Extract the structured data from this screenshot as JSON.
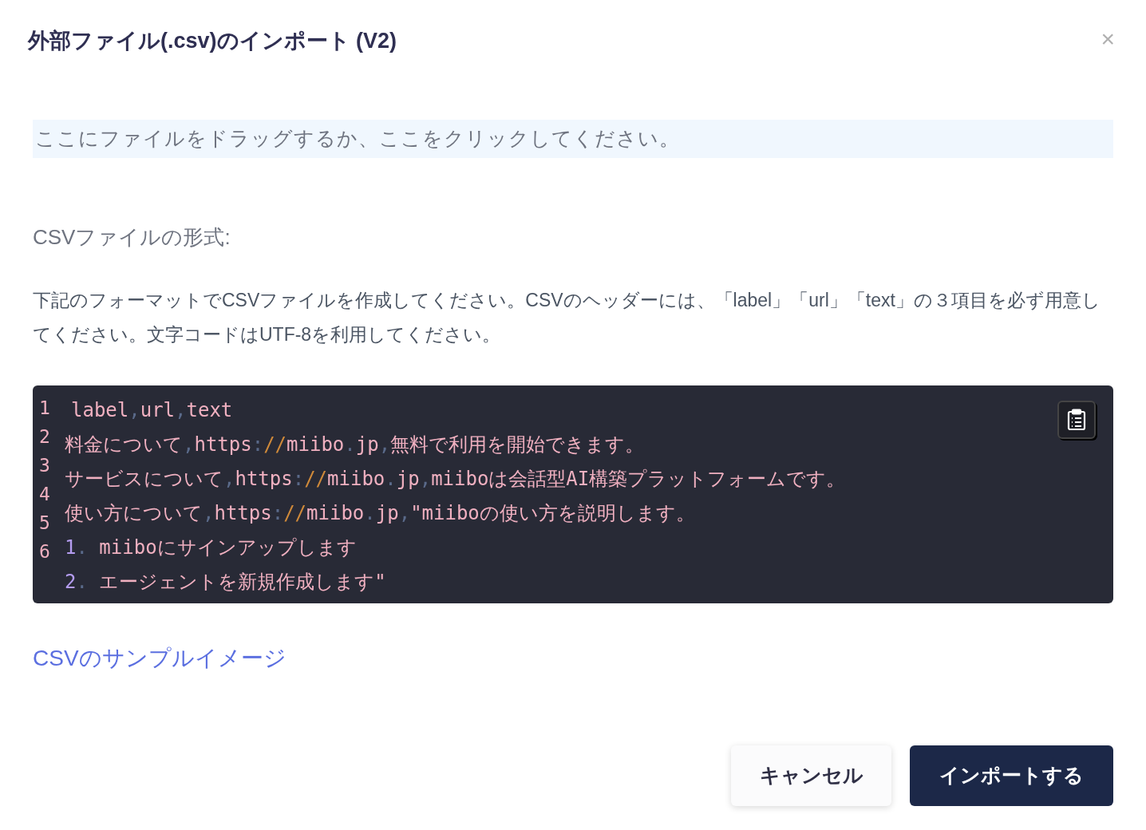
{
  "dialog": {
    "title": "外部ファイル(.csv)のインポート (V2)",
    "close": "×"
  },
  "dropzone": {
    "text": "ここにファイルをドラッグするか、ここをクリックしてください。"
  },
  "format_heading": "CSVファイルの形式:",
  "description": "下記のフォーマットでCSVファイルを作成してください。CSVのヘッダーには、「label」「url」「text」の３項目を必ず用意してください。文字コードはUTF-8を利用してください。",
  "code": {
    "line_numbers": [
      "1",
      "2",
      "3",
      "4",
      "5",
      "6"
    ],
    "lines": [
      [
        {
          "kind": "text",
          "text": "label"
        },
        {
          "kind": "punct",
          "text": ","
        },
        {
          "kind": "text",
          "text": "url"
        },
        {
          "kind": "punct",
          "text": ","
        },
        {
          "kind": "text",
          "text": "text"
        }
      ],
      [
        {
          "kind": "text",
          "text": "料金について"
        },
        {
          "kind": "punct",
          "text": ","
        },
        {
          "kind": "text",
          "text": "https"
        },
        {
          "kind": "punct",
          "text": ":"
        },
        {
          "kind": "slash",
          "text": "//"
        },
        {
          "kind": "text",
          "text": "miibo"
        },
        {
          "kind": "punct",
          "text": "."
        },
        {
          "kind": "text",
          "text": "jp"
        },
        {
          "kind": "punct",
          "text": ","
        },
        {
          "kind": "text",
          "text": "無料で利用を開始できます。"
        }
      ],
      [
        {
          "kind": "text",
          "text": "サービスについて"
        },
        {
          "kind": "punct",
          "text": ","
        },
        {
          "kind": "text",
          "text": "https"
        },
        {
          "kind": "punct",
          "text": ":"
        },
        {
          "kind": "slash",
          "text": "//"
        },
        {
          "kind": "text",
          "text": "miibo"
        },
        {
          "kind": "punct",
          "text": "."
        },
        {
          "kind": "text",
          "text": "jp"
        },
        {
          "kind": "punct",
          "text": ","
        },
        {
          "kind": "text",
          "text": "miiboは会話型AI構築プラットフォームです。"
        }
      ],
      [
        {
          "kind": "text",
          "text": "使い方について"
        },
        {
          "kind": "punct",
          "text": ","
        },
        {
          "kind": "text",
          "text": "https"
        },
        {
          "kind": "punct",
          "text": ":"
        },
        {
          "kind": "slash",
          "text": "//"
        },
        {
          "kind": "text",
          "text": "miibo"
        },
        {
          "kind": "punct",
          "text": "."
        },
        {
          "kind": "text",
          "text": "jp"
        },
        {
          "kind": "punct",
          "text": ","
        },
        {
          "kind": "text",
          "text": "\"miiboの使い方を説明します。"
        }
      ],
      [
        {
          "kind": "number",
          "text": "1"
        },
        {
          "kind": "punct",
          "text": ". "
        },
        {
          "kind": "text",
          "text": "miiboにサインアップします"
        }
      ],
      [
        {
          "kind": "number",
          "text": "2"
        },
        {
          "kind": "punct",
          "text": ". "
        },
        {
          "kind": "text",
          "text": "エージェントを新規作成します\""
        }
      ]
    ]
  },
  "sample_link": "CSVのサンプルイメージ",
  "buttons": [
    {
      "kind": "secondary",
      "label": "キャンセル"
    },
    {
      "kind": "primary",
      "label": "インポートする"
    }
  ]
}
